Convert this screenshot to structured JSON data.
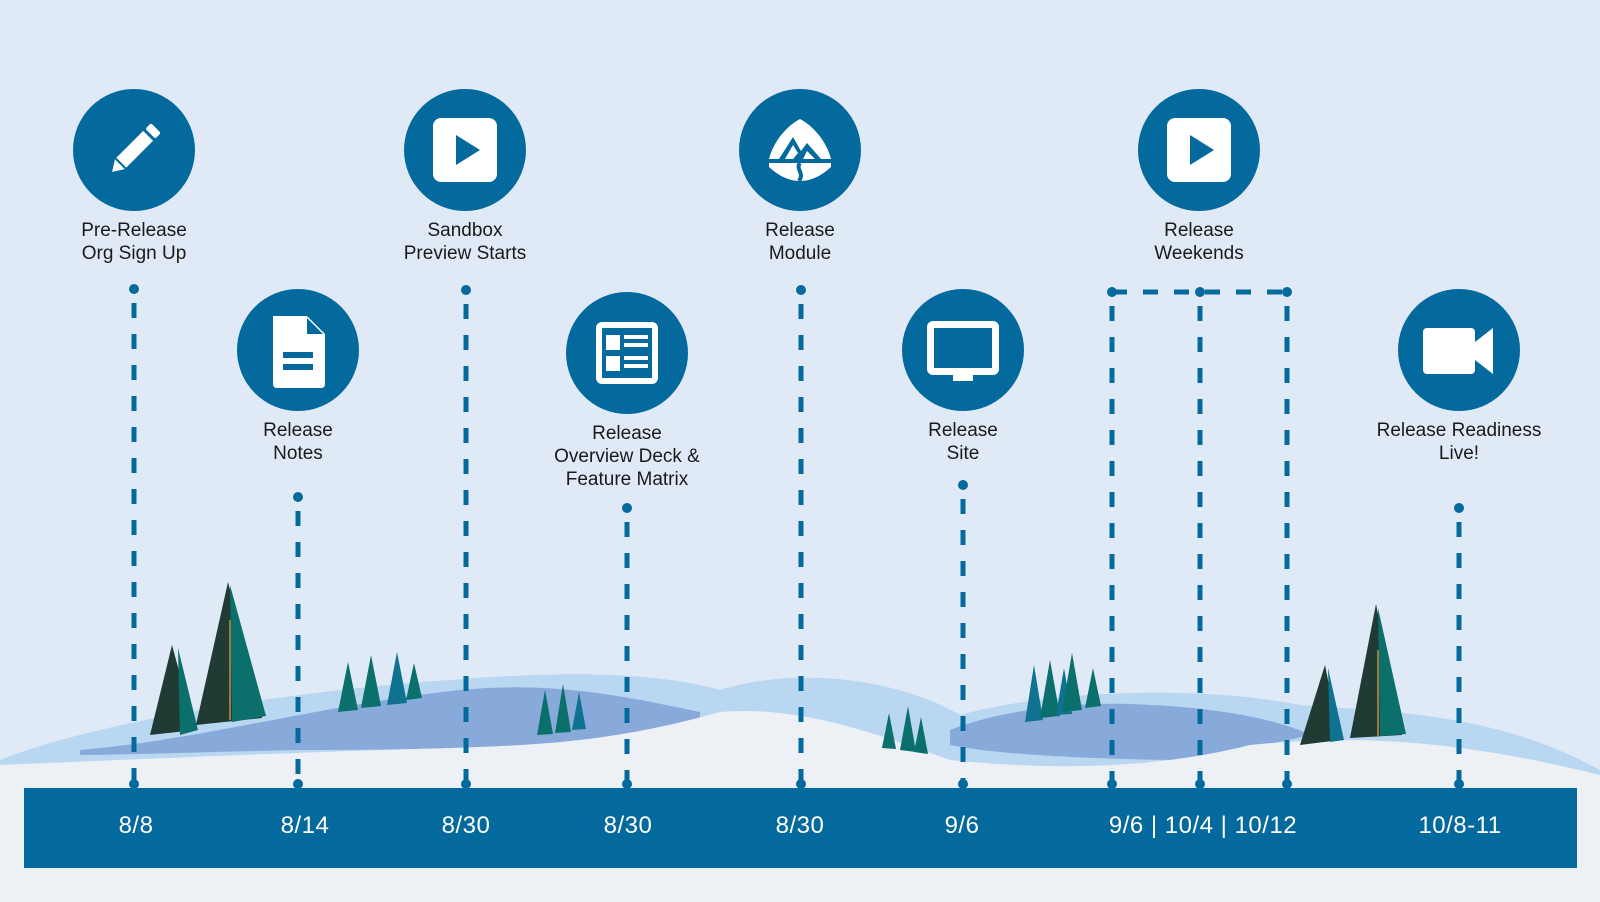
{
  "colors": {
    "background": "#e0eaf6",
    "accent": "#04699c",
    "snow": "#edf1f5",
    "hill_light": "#b9d7f1",
    "hill_shadow": "#7c9fd6",
    "tree_dark": "#1f3b34",
    "tree_teal": "#0b6f6c",
    "tree_blue": "#0e7290",
    "trunk": "#9b7a3a",
    "label_text": "#1a1a1a",
    "date_text": "#ffffff"
  },
  "milestones": [
    {
      "label": "Pre-Release\nOrg Sign Up",
      "icon": "pencil-icon",
      "date": "8/8"
    },
    {
      "label": "Release\nNotes",
      "icon": "document-icon",
      "date": "8/14"
    },
    {
      "label": "Sandbox\nPreview Starts",
      "icon": "play-icon",
      "date": "8/30"
    },
    {
      "label": "Release\nOverview Deck &\nFeature Matrix",
      "icon": "news-list-icon",
      "date": "8/30"
    },
    {
      "label": "Release\nModule",
      "icon": "trailhead-mountain-icon",
      "date": "8/30"
    },
    {
      "label": "Release\nSite",
      "icon": "monitor-icon",
      "date": "9/6"
    },
    {
      "label": "Release\nWeekends",
      "icon": "play-icon",
      "date": "9/6 | 10/4 | 10/12"
    },
    {
      "label": "Release Readiness\nLive!",
      "icon": "video-camera-icon",
      "date": "10/8-11"
    }
  ]
}
